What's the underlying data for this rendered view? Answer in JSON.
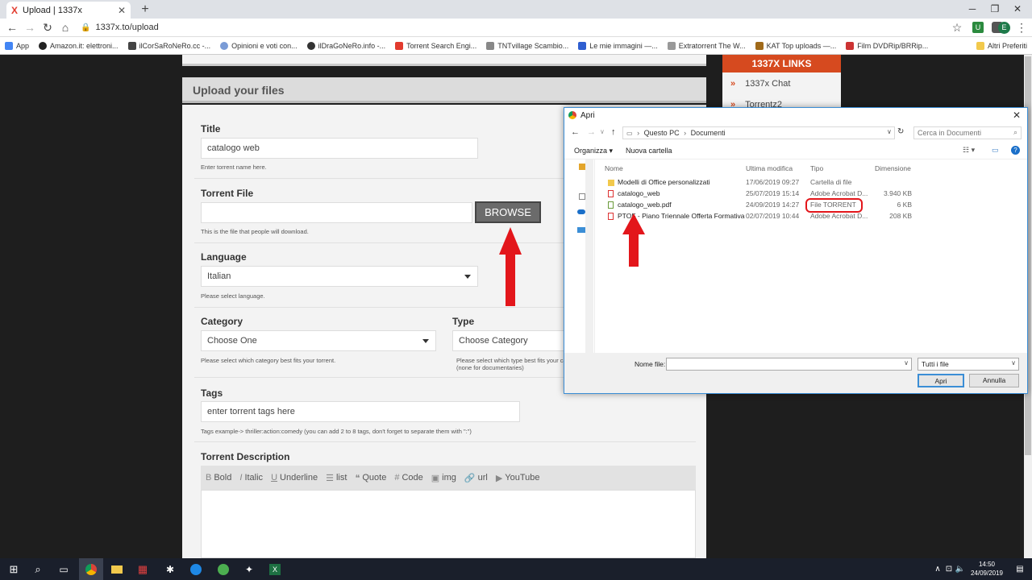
{
  "browser": {
    "tab_title": "Upload | 1337x",
    "tab_favicon": "X",
    "url": "1337x.to/upload",
    "profile_initial": "E",
    "bookmarks": [
      "App",
      "Amazon.it: elettroni...",
      "ilCorSaRoNeRo.cc -...",
      "Opinioni e voti con...",
      "ilDraGoNeRo.info -...",
      "Torrent Search Engi...",
      "TNTvillage Scambio...",
      "Le mie immagini —...",
      "Extratorrent The W...",
      "KAT Top uploads —...",
      "Film DVDRip/BRRip..."
    ],
    "other_bookmarks": "Altri Preferiti"
  },
  "form": {
    "header": "Upload your files",
    "title_label": "Title",
    "title_value": "catalogo web",
    "title_hint": "Enter torrent name here.",
    "torrent_file_label": "Torrent File",
    "browse_label": "BROWSE",
    "torrent_file_hint": "This is the file that people will download.",
    "language_label": "Language",
    "language_value": "Italian",
    "language_hint": "Please select language.",
    "category_label": "Category",
    "category_value": "Choose One",
    "category_hint": "Please select which category best fits your torrent.",
    "type_label": "Type",
    "type_value": "Choose Category",
    "type_hint": "Please select which type best fits your ca",
    "type_hint2": "(none for documentaries)",
    "tags_label": "Tags",
    "tags_placeholder": "enter torrent tags here",
    "tags_hint": "Tags example-> thriller:action:comedy (you can add 2 to 8 tags, don't forget to separate them with \":\")",
    "description_label": "Torrent Description",
    "toolbar": {
      "bold": "Bold",
      "italic": "Italic",
      "underline": "Underline",
      "list": "list",
      "quote": "Quote",
      "code": "Code",
      "img": "img",
      "url": "url",
      "youtube": "YouTube"
    }
  },
  "sidebar": {
    "links_header": "1337X LINKS",
    "links": [
      "1337x Chat",
      "Torrentz2"
    ]
  },
  "dialog": {
    "title": "Apri",
    "path": [
      "Questo PC",
      "Documenti"
    ],
    "search_placeholder": "Cerca in Documenti",
    "organize": "Organizza",
    "new_folder": "Nuova cartella",
    "columns": {
      "name": "Nome",
      "modified": "Ultima modifica",
      "type": "Tipo",
      "size": "Dimensione"
    },
    "files": [
      {
        "name": "Modelli di Office personalizzati",
        "modified": "17/06/2019 09:27",
        "type": "Cartella di file",
        "size": ""
      },
      {
        "name": "catalogo_web",
        "modified": "25/07/2019 15:14",
        "type": "Adobe Acrobat D...",
        "size": "3.940 KB"
      },
      {
        "name": "catalogo_web.pdf",
        "modified": "24/09/2019 14:27",
        "type": "File TORRENT",
        "size": "6 KB"
      },
      {
        "name": "PTOF - Piano Triennale Offerta Formativa",
        "modified": "02/07/2019 10:44",
        "type": "Adobe Acrobat D...",
        "size": "208 KB"
      }
    ],
    "filename_label": "Nome file:",
    "filetype_value": "Tutti i file",
    "open_button": "Apri",
    "cancel_button": "Annulla"
  },
  "taskbar": {
    "time": "14:50",
    "date": "24/09/2019"
  },
  "colors": {
    "accent": "#d64a1f",
    "annotation_red": "#e3161b",
    "dialog_border": "#3b8ed6"
  }
}
